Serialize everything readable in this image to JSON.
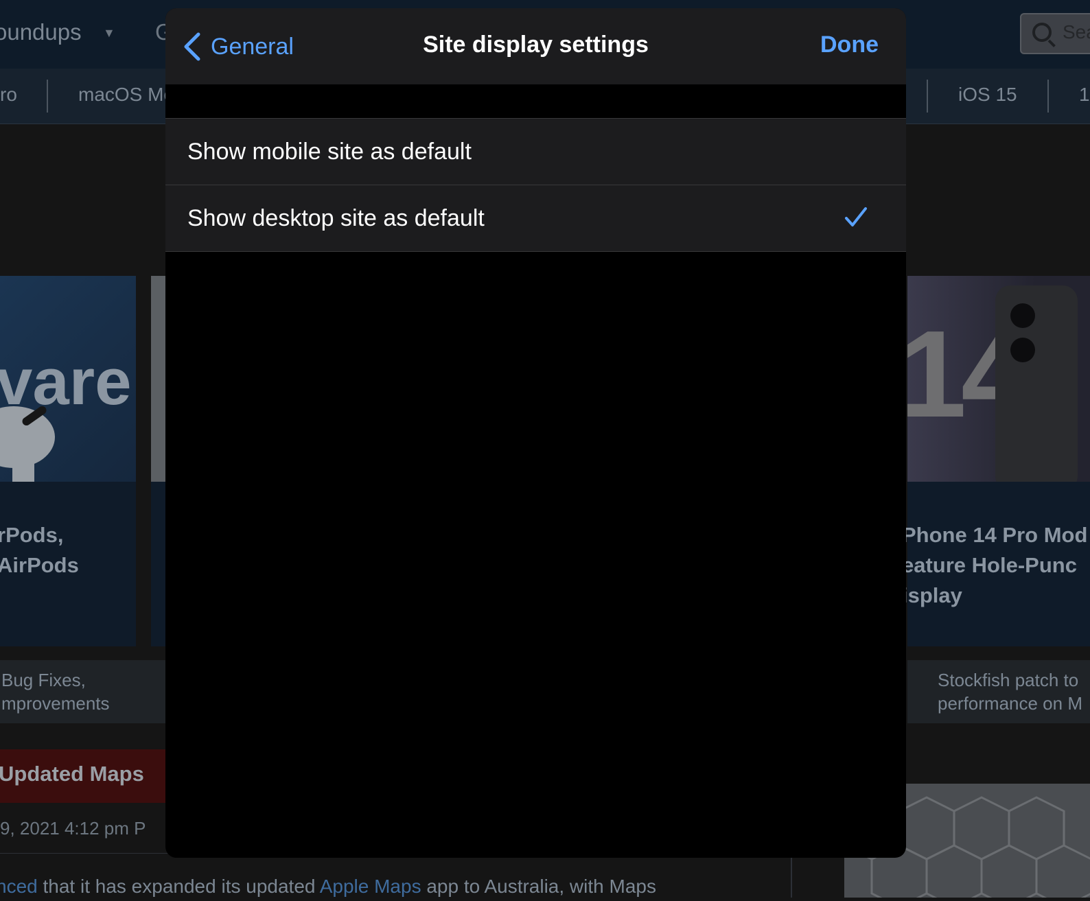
{
  "background_page": {
    "top_nav": {
      "roundups": "oundups",
      "partial": "G"
    },
    "search": {
      "placeholder": "Sea"
    },
    "sub_nav": [
      "ro",
      "macOS Mo",
      "iOS 15",
      "1"
    ],
    "cards": [
      {
        "title": "rPods,\nAirPods",
        "image_text": "vare"
      },
      {
        "title": "Phone 14 Pro Mod\neature Hole-Punc\nisplay",
        "image_text": "14"
      }
    ],
    "news": [
      {
        "text": "Bug Fixes,\nmprovements"
      },
      {
        "text": "Stockfish patch to\nperformance on M"
      }
    ],
    "article": {
      "title": "Updated Maps",
      "date": "9, 2021 4:12 pm P",
      "body_before": "nced",
      "body_middle": " that it has expanded its updated ",
      "body_link": "Apple Maps",
      "body_after": " app to Australia, with Maps"
    }
  },
  "sheet": {
    "back_label": "General",
    "title": "Site display settings",
    "done_label": "Done",
    "options": [
      {
        "label": "Show mobile site as default",
        "selected": false
      },
      {
        "label": "Show desktop site as default",
        "selected": true
      }
    ]
  },
  "colors": {
    "accent": "#5aa2ff",
    "sheet_bg": "#000000",
    "row_bg": "#1c1c1e"
  }
}
